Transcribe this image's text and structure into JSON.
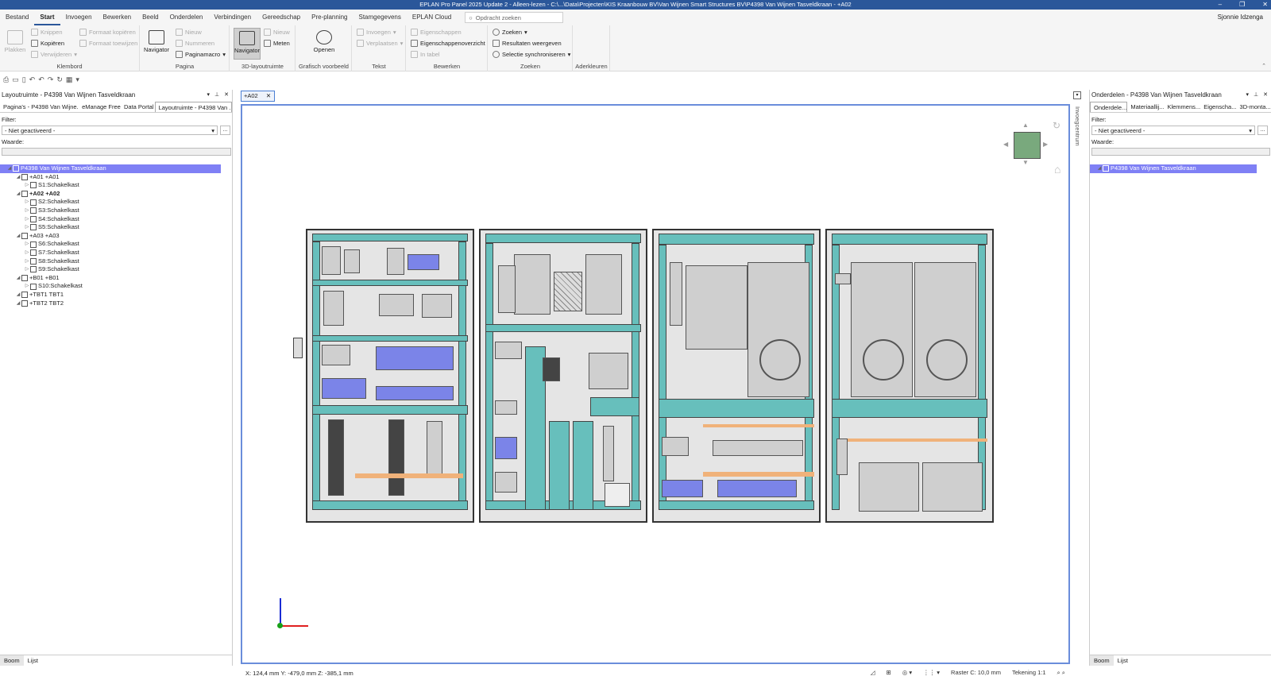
{
  "window": {
    "title": "EPLAN Pro Panel 2025 Update 2 - Alleen-lezen - C:\\...\\Data\\Projecten\\KIS Kraanbouw BV\\Van Wijnen Smart Structures BV\\P4398 Van Wijnen Tasveldkraan - +A02",
    "controls": [
      "–",
      "❐",
      "✕"
    ]
  },
  "menu": {
    "tabs": [
      "Bestand",
      "Start",
      "Invoegen",
      "Bewerken",
      "Beeld",
      "Onderdelen",
      "Verbindingen",
      "Gereedschap",
      "Pre-planning",
      "Stamgegevens",
      "EPLAN Cloud"
    ],
    "active": "Start",
    "search_placeholder": "Opdracht zoeken",
    "user": "Sjonnie Idzenga"
  },
  "ribbon": {
    "klembord": {
      "label": "Klembord",
      "plakken": "Plakken",
      "knippen": "Knippen",
      "kopieren": "Kopiëren",
      "verwijderen": "Verwijderen",
      "formaat_kopieren": "Formaat kopiëren",
      "formaat_toewijzen": "Formaat toewijzen"
    },
    "pagina": {
      "label": "Pagina",
      "navigator": "Navigator",
      "nieuw": "Nieuw",
      "nummeren": "Nummeren",
      "paginamacro": "Paginamacro"
    },
    "layout3d": {
      "label": "3D-layoutruimte",
      "navigator": "Navigator",
      "nieuw": "Nieuw",
      "meten": "Meten"
    },
    "grafisch": {
      "label": "Grafisch voorbeeld",
      "openen": "Openen"
    },
    "tekst": {
      "label": "Tekst",
      "invoegen": "Invoegen",
      "verplaatsen": "Verplaatsen"
    },
    "bewerken": {
      "label": "Bewerken",
      "eigenschappen": "Eigenschappen",
      "eigenschappenoverzicht": "Eigenschappenoverzicht",
      "in_tabel": "In tabel"
    },
    "zoeken": {
      "label": "Zoeken",
      "zoeken": "Zoeken",
      "resultaten": "Resultaten weergeven",
      "selectie": "Selectie synchroniseren"
    },
    "aderkleuren": {
      "label": "Aderkleuren"
    }
  },
  "left_panel": {
    "title": "Layoutruimte - P4398 Van Wijnen Tasveldkraan",
    "tabs": [
      "Pagina's - P4398 Van Wijne...",
      "eManage Free",
      "Data Portal",
      "Layoutruimte - P4398 Van ..."
    ],
    "active_tab": 3,
    "filter_label": "Filter:",
    "filter_value": "- Niet geactiveerd -",
    "value_label": "Waarde:",
    "tree": [
      {
        "label": "P4398 Van Wijnen Tasveldkraan",
        "level": 0,
        "selected": true
      },
      {
        "label": "+A01 +A01",
        "level": 1
      },
      {
        "label": "S1:Schakelkast",
        "level": 2
      },
      {
        "label": "+A02 +A02",
        "level": 1,
        "bold": true
      },
      {
        "label": "S2:Schakelkast",
        "level": 2
      },
      {
        "label": "S3:Schakelkast",
        "level": 2
      },
      {
        "label": "S4:Schakelkast",
        "level": 2
      },
      {
        "label": "S5:Schakelkast",
        "level": 2
      },
      {
        "label": "+A03 +A03",
        "level": 1
      },
      {
        "label": "S6:Schakelkast",
        "level": 2
      },
      {
        "label": "S7:Schakelkast",
        "level": 2
      },
      {
        "label": "S8:Schakelkast",
        "level": 2
      },
      {
        "label": "S9:Schakelkast",
        "level": 2
      },
      {
        "label": "+B01 +B01",
        "level": 1
      },
      {
        "label": "S10:Schakelkast",
        "level": 2
      },
      {
        "label": "+TBT1 TBT1",
        "level": 1
      },
      {
        "label": "+TBT2 TBT2",
        "level": 1
      }
    ],
    "bottom_tabs": [
      "Boom",
      "Lijst"
    ]
  },
  "doc_tab": "+A02",
  "viewport": {
    "side_tab": "Invoegcentrum",
    "coordinates": "X: 124,4 mm Y: -479,0 mm Z: -385,1 mm",
    "raster": "Raster C: 10,0 mm",
    "tekening": "Tekening 1:1"
  },
  "right_panel": {
    "title": "Onderdelen - P4398 Van Wijnen Tasveldkraan",
    "tabs": [
      "Onderdele...",
      "Materiaallij...",
      "Klemmens...",
      "Eigenscha...",
      "3D-monta..."
    ],
    "active_tab": 0,
    "filter_label": "Filter:",
    "filter_value": "- Niet geactiveerd -",
    "value_label": "Waarde:",
    "tree": [
      {
        "label": "P4398 Van Wijnen Tasveldkraan",
        "selected": true
      }
    ],
    "bottom_tabs": [
      "Boom",
      "Lijst"
    ]
  },
  "colors": {
    "accent": "#2b579a",
    "selection": "#7f80f5",
    "duct": "#67bfbc"
  }
}
